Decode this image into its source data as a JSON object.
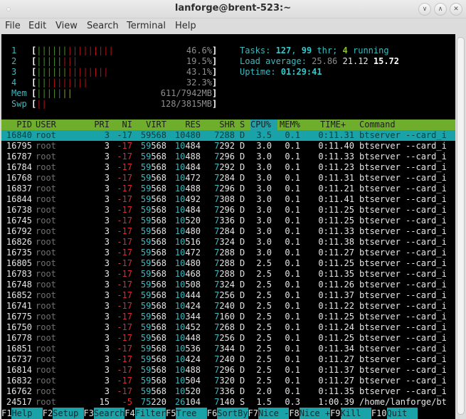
{
  "window": {
    "title": "lanforge@brent-523:~",
    "controls": [
      "minimize",
      "maximize",
      "close"
    ]
  },
  "menubar": [
    "File",
    "Edit",
    "View",
    "Search",
    "Terminal",
    "Help"
  ],
  "meters": [
    {
      "label": "1",
      "green": 6,
      "red": 9,
      "blue": 0,
      "yellow": 0,
      "value": "46.6%"
    },
    {
      "label": "2",
      "green": 5,
      "red": 3,
      "blue": 0,
      "yellow": 0,
      "value": "19.5%"
    },
    {
      "label": "3",
      "green": 6,
      "red": 8,
      "blue": 0,
      "yellow": 0,
      "value": "43.1%"
    },
    {
      "label": "4",
      "green": 2,
      "red": 8,
      "blue": 0,
      "yellow": 0,
      "value": "32.3%"
    },
    {
      "label": "Mem",
      "green": 4,
      "red": 0,
      "blue": 1,
      "yellow": 2,
      "value": "611/7942MB"
    },
    {
      "label": "Swp",
      "green": 0,
      "red": 2,
      "blue": 0,
      "yellow": 0,
      "value": "128/3815MB"
    }
  ],
  "summary": {
    "tasks_label": "Tasks: ",
    "tasks": "127",
    "thr": "99",
    "thr_label": " thr; ",
    "running": "4",
    "running_label": " running",
    "load_label": "Load average: ",
    "load1": "25.86",
    "load5": "21.12",
    "load15": "15.72",
    "uptime_label": "Uptime: ",
    "uptime": "01:29:41"
  },
  "columns": [
    "PID",
    "USER",
    "PRI",
    "NI",
    "VIRT",
    "RES",
    "SHR",
    "S",
    "CPU%",
    "MEM%",
    "TIME+",
    "Command"
  ],
  "sort_column": "CPU%",
  "processes": [
    {
      "pid": "16840",
      "user": "root",
      "pri": "3",
      "ni": "-17",
      "virt": "59568",
      "res": "10480",
      "shr": "7288",
      "s": "D",
      "cpu": "3.5",
      "mem": "0.1",
      "time": "0:11.31",
      "cmd": "btserver --card_i",
      "selected": true
    },
    {
      "pid": "16795",
      "user": "root",
      "pri": "3",
      "ni": "-17",
      "virt": "59568",
      "res": "10484",
      "shr": "7292",
      "s": "D",
      "cpu": "3.0",
      "mem": "0.1",
      "time": "0:11.40",
      "cmd": "btserver --card_i"
    },
    {
      "pid": "16787",
      "user": "root",
      "pri": "3",
      "ni": "-17",
      "virt": "59568",
      "res": "10488",
      "shr": "7296",
      "s": "D",
      "cpu": "3.0",
      "mem": "0.1",
      "time": "0:11.33",
      "cmd": "btserver --card_i"
    },
    {
      "pid": "16784",
      "user": "root",
      "pri": "3",
      "ni": "-17",
      "virt": "59568",
      "res": "10484",
      "shr": "7292",
      "s": "D",
      "cpu": "3.0",
      "mem": "0.1",
      "time": "0:11.23",
      "cmd": "btserver --card_i"
    },
    {
      "pid": "16768",
      "user": "root",
      "pri": "3",
      "ni": "-17",
      "virt": "59568",
      "res": "10472",
      "shr": "7284",
      "s": "D",
      "cpu": "3.0",
      "mem": "0.1",
      "time": "0:11.31",
      "cmd": "btserver --card_i"
    },
    {
      "pid": "16837",
      "user": "root",
      "pri": "3",
      "ni": "-17",
      "virt": "59568",
      "res": "10488",
      "shr": "7296",
      "s": "D",
      "cpu": "3.0",
      "mem": "0.1",
      "time": "0:11.21",
      "cmd": "btserver --card_i"
    },
    {
      "pid": "16844",
      "user": "root",
      "pri": "3",
      "ni": "-17",
      "virt": "59568",
      "res": "10492",
      "shr": "7308",
      "s": "D",
      "cpu": "3.0",
      "mem": "0.1",
      "time": "0:11.41",
      "cmd": "btserver --card_i"
    },
    {
      "pid": "16738",
      "user": "root",
      "pri": "3",
      "ni": "-17",
      "virt": "59568",
      "res": "10484",
      "shr": "7296",
      "s": "D",
      "cpu": "3.0",
      "mem": "0.1",
      "time": "0:11.25",
      "cmd": "btserver --card_i"
    },
    {
      "pid": "16745",
      "user": "root",
      "pri": "3",
      "ni": "-17",
      "virt": "59568",
      "res": "10520",
      "shr": "7336",
      "s": "D",
      "cpu": "3.0",
      "mem": "0.1",
      "time": "0:11.25",
      "cmd": "btserver --card_i"
    },
    {
      "pid": "16792",
      "user": "root",
      "pri": "3",
      "ni": "-17",
      "virt": "59568",
      "res": "10480",
      "shr": "7284",
      "s": "D",
      "cpu": "3.0",
      "mem": "0.1",
      "time": "0:11.33",
      "cmd": "btserver --card_i"
    },
    {
      "pid": "16826",
      "user": "root",
      "pri": "3",
      "ni": "-17",
      "virt": "59568",
      "res": "10516",
      "shr": "7324",
      "s": "D",
      "cpu": "3.0",
      "mem": "0.1",
      "time": "0:11.38",
      "cmd": "btserver --card_i"
    },
    {
      "pid": "16735",
      "user": "root",
      "pri": "3",
      "ni": "-17",
      "virt": "59568",
      "res": "10472",
      "shr": "7288",
      "s": "D",
      "cpu": "3.0",
      "mem": "0.1",
      "time": "0:11.27",
      "cmd": "btserver --card_i"
    },
    {
      "pid": "16805",
      "user": "root",
      "pri": "3",
      "ni": "-17",
      "virt": "59568",
      "res": "10480",
      "shr": "7288",
      "s": "D",
      "cpu": "2.5",
      "mem": "0.1",
      "time": "0:11.25",
      "cmd": "btserver --card_i"
    },
    {
      "pid": "16783",
      "user": "root",
      "pri": "3",
      "ni": "-17",
      "virt": "59568",
      "res": "10468",
      "shr": "7288",
      "s": "D",
      "cpu": "2.5",
      "mem": "0.1",
      "time": "0:11.35",
      "cmd": "btserver --card_i"
    },
    {
      "pid": "16748",
      "user": "root",
      "pri": "3",
      "ni": "-17",
      "virt": "59568",
      "res": "10508",
      "shr": "7324",
      "s": "D",
      "cpu": "2.5",
      "mem": "0.1",
      "time": "0:11.26",
      "cmd": "btserver --card_i"
    },
    {
      "pid": "16852",
      "user": "root",
      "pri": "3",
      "ni": "-17",
      "virt": "59568",
      "res": "10444",
      "shr": "7256",
      "s": "D",
      "cpu": "2.5",
      "mem": "0.1",
      "time": "0:11.37",
      "cmd": "btserver --card_i"
    },
    {
      "pid": "16741",
      "user": "root",
      "pri": "3",
      "ni": "-17",
      "virt": "59568",
      "res": "10424",
      "shr": "7240",
      "s": "D",
      "cpu": "2.5",
      "mem": "0.1",
      "time": "0:11.22",
      "cmd": "btserver --card_i"
    },
    {
      "pid": "16775",
      "user": "root",
      "pri": "3",
      "ni": "-17",
      "virt": "59568",
      "res": "10344",
      "shr": "7160",
      "s": "D",
      "cpu": "2.5",
      "mem": "0.1",
      "time": "0:11.25",
      "cmd": "btserver --card_i"
    },
    {
      "pid": "16750",
      "user": "root",
      "pri": "3",
      "ni": "-17",
      "virt": "59568",
      "res": "10452",
      "shr": "7268",
      "s": "D",
      "cpu": "2.5",
      "mem": "0.1",
      "time": "0:11.24",
      "cmd": "btserver --card_i"
    },
    {
      "pid": "16778",
      "user": "root",
      "pri": "3",
      "ni": "-17",
      "virt": "59568",
      "res": "10448",
      "shr": "7256",
      "s": "D",
      "cpu": "2.5",
      "mem": "0.1",
      "time": "0:11.25",
      "cmd": "btserver --card_i"
    },
    {
      "pid": "16851",
      "user": "root",
      "pri": "3",
      "ni": "-17",
      "virt": "59568",
      "res": "10536",
      "shr": "7344",
      "s": "D",
      "cpu": "2.5",
      "mem": "0.1",
      "time": "0:11.34",
      "cmd": "btserver --card_i"
    },
    {
      "pid": "16737",
      "user": "root",
      "pri": "3",
      "ni": "-17",
      "virt": "59568",
      "res": "10424",
      "shr": "7240",
      "s": "D",
      "cpu": "2.5",
      "mem": "0.1",
      "time": "0:11.27",
      "cmd": "btserver --card_i"
    },
    {
      "pid": "16814",
      "user": "root",
      "pri": "3",
      "ni": "-17",
      "virt": "59568",
      "res": "10488",
      "shr": "7296",
      "s": "D",
      "cpu": "2.5",
      "mem": "0.1",
      "time": "0:11.37",
      "cmd": "btserver --card_i"
    },
    {
      "pid": "16832",
      "user": "root",
      "pri": "3",
      "ni": "-17",
      "virt": "59568",
      "res": "10504",
      "shr": "7320",
      "s": "D",
      "cpu": "2.5",
      "mem": "0.1",
      "time": "0:11.27",
      "cmd": "btserver --card_i"
    },
    {
      "pid": "16762",
      "user": "root",
      "pri": "3",
      "ni": "-17",
      "virt": "59568",
      "res": "10520",
      "shr": "7336",
      "s": "D",
      "cpu": "2.0",
      "mem": "0.1",
      "time": "0:11.35",
      "cmd": "btserver --card_i"
    },
    {
      "pid": "24517",
      "user": "root",
      "pri": "15",
      "ni": "-5",
      "virt": "75220",
      "res": "26104",
      "shr": "7140",
      "s": "S",
      "cpu": "1.5",
      "mem": "0.3",
      "time": "1:00.39",
      "cmd": "/home/lanforge/bt"
    }
  ],
  "footer": [
    {
      "key": "F1",
      "label": "Help  "
    },
    {
      "key": "F2",
      "label": "Setup "
    },
    {
      "key": "F3",
      "label": "Search"
    },
    {
      "key": "F4",
      "label": "Filter"
    },
    {
      "key": "F5",
      "label": "Tree  "
    },
    {
      "key": "F6",
      "label": "SortBy"
    },
    {
      "key": "F7",
      "label": "Nice -"
    },
    {
      "key": "F8",
      "label": "Nice +"
    },
    {
      "key": "F9",
      "label": "Kill  "
    },
    {
      "key": "F10",
      "label": "Quit  "
    }
  ]
}
